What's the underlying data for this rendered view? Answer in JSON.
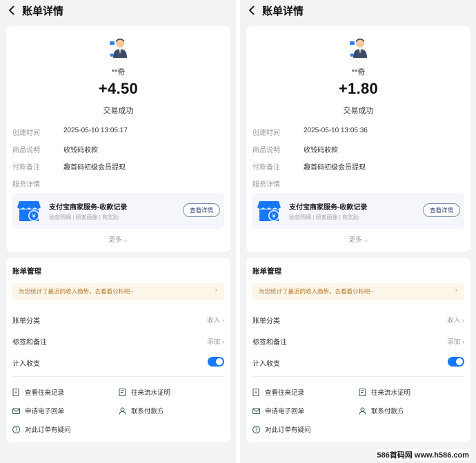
{
  "header": {
    "title": "账单详情"
  },
  "colors": {
    "accent": "#1677ff",
    "banner_text": "#b4772b",
    "banner_bg": "#fbf6e7"
  },
  "panels": [
    {
      "payer": "**奇",
      "amount": "+4.50",
      "status": "交易成功",
      "details": [
        {
          "key": "创建时间",
          "value": "2025-05-10 13:05:17"
        },
        {
          "key": "商品说明",
          "value": "收钱码收款"
        },
        {
          "key": "付款备注",
          "value": "趣首码初级会员提现"
        },
        {
          "key": "服务详情",
          "value": ""
        }
      ],
      "service": {
        "title": "支付宝商家服务-收款记录",
        "subtitle": "收款明细 | 顾客画像 | 有奖励",
        "button": "查看详情"
      },
      "more": "更多"
    },
    {
      "payer": "**奇",
      "amount": "+1.80",
      "status": "交易成功",
      "details": [
        {
          "key": "创建时间",
          "value": "2025-05-10 13:05:36"
        },
        {
          "key": "商品说明",
          "value": "收钱码收款"
        },
        {
          "key": "付款备注",
          "value": "趣首码初级会员提现"
        },
        {
          "key": "服务详情",
          "value": ""
        }
      ],
      "service": {
        "title": "支付宝商家服务-收款记录",
        "subtitle": "收款明细 | 顾客画像 | 有奖励",
        "button": "查看详情"
      },
      "more": "更多"
    }
  ],
  "management": {
    "title": "账单管理",
    "banner": "为您统计了最近的收入趋势，去看看分析吧~",
    "category": {
      "label": "账单分类",
      "value": "收入"
    },
    "tags": {
      "label": "标签和备注",
      "value": "添加"
    },
    "count_in": {
      "label": "计入收支",
      "enabled": true
    },
    "actions": {
      "records": "查看往来记录",
      "flow_proof": "往来流水证明",
      "e_receipt": "申请电子回单",
      "contact": "联系付款方",
      "question": "对此订单有疑问"
    }
  },
  "watermark": "586首码网 www.h586.com"
}
